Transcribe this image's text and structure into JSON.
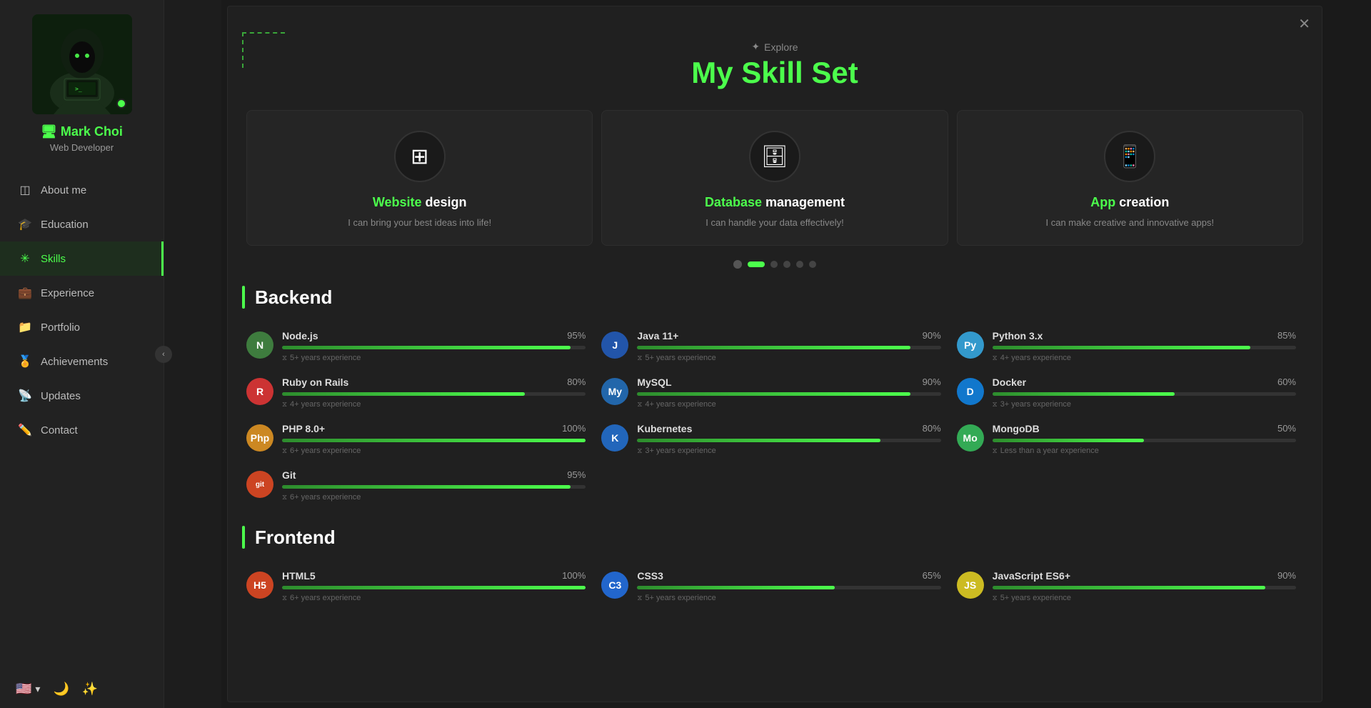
{
  "profile": {
    "name_plain": "Mark",
    "name_colored": " Choi",
    "title": "Web Developer",
    "online": true
  },
  "nav": {
    "items": [
      {
        "id": "about",
        "label": "About me",
        "icon": "👤",
        "active": false
      },
      {
        "id": "education",
        "label": "Education",
        "icon": "🎓",
        "active": false
      },
      {
        "id": "skills",
        "label": "Skills",
        "icon": "✳",
        "active": true
      },
      {
        "id": "experience",
        "label": "Experience",
        "icon": "💼",
        "active": false
      },
      {
        "id": "portfolio",
        "label": "Portfolio",
        "icon": "📁",
        "active": false
      },
      {
        "id": "achievements",
        "label": "Achievements",
        "icon": "🏅",
        "active": false
      },
      {
        "id": "updates",
        "label": "Updates",
        "icon": "📡",
        "active": false
      },
      {
        "id": "contact",
        "label": "Contact",
        "icon": "✏️",
        "active": false
      }
    ]
  },
  "header": {
    "explore_label": "Explore",
    "explore_icon": "✦",
    "title_plain": "My ",
    "title_colored": "Skill",
    "title_rest": " Set"
  },
  "skill_cards": [
    {
      "icon": "⊞",
      "title_green": "Website",
      "title_rest": " design",
      "desc": "I can bring your best ideas into life!"
    },
    {
      "icon": "🗄",
      "title_green": "Database",
      "title_rest": " management",
      "desc": "I can handle your data effectively!"
    },
    {
      "icon": "📱",
      "title_green": "App",
      "title_rest": " creation",
      "desc": "I can make creative and innovative apps!"
    }
  ],
  "sections": {
    "backend": {
      "label": "Backend",
      "skills": [
        {
          "name": "Node.js",
          "pct": 95,
          "pct_label": "95%",
          "exp": "5+ years experience",
          "color": "#3e7c3e",
          "initials": "N"
        },
        {
          "name": "Java 11+",
          "pct": 90,
          "pct_label": "90%",
          "exp": "5+ years experience",
          "color": "#2255aa",
          "initials": "J"
        },
        {
          "name": "Python 3.x",
          "pct": 85,
          "pct_label": "85%",
          "exp": "4+ years experience",
          "color": "#3399cc",
          "initials": "Py"
        },
        {
          "name": "Ruby on Rails",
          "pct": 80,
          "pct_label": "80%",
          "exp": "4+ years experience",
          "color": "#cc3333",
          "initials": "R"
        },
        {
          "name": "MySQL",
          "pct": 90,
          "pct_label": "90%",
          "exp": "4+ years experience",
          "color": "#2266aa",
          "initials": "My"
        },
        {
          "name": "Docker",
          "pct": 60,
          "pct_label": "60%",
          "exp": "3+ years experience",
          "color": "#1177cc",
          "initials": "D"
        },
        {
          "name": "PHP 8.0+",
          "pct": 100,
          "pct_label": "100%",
          "exp": "6+ years experience",
          "color": "#cc8822",
          "initials": "Php"
        },
        {
          "name": "Kubernetes",
          "pct": 80,
          "pct_label": "80%",
          "exp": "3+ years experience",
          "color": "#2266bb",
          "initials": "K"
        },
        {
          "name": "MongoDB",
          "pct": 50,
          "pct_label": "50%",
          "exp": "Less than a year experience",
          "color": "#33aa55",
          "initials": "Mo"
        },
        {
          "name": "Git",
          "pct": 95,
          "pct_label": "95%",
          "exp": "6+ years experience",
          "color": "#cc4422",
          "initials": "git"
        }
      ]
    },
    "frontend": {
      "label": "Frontend",
      "skills": [
        {
          "name": "HTML5",
          "pct": 100,
          "pct_label": "100%",
          "exp": "6+ years experience",
          "color": "#cc4422",
          "initials": "H5"
        },
        {
          "name": "CSS3",
          "pct": 65,
          "pct_label": "65%",
          "exp": "5+ years experience",
          "color": "#2266cc",
          "initials": "C3"
        },
        {
          "name": "JavaScript ES6+",
          "pct": 90,
          "pct_label": "90%",
          "exp": "5+ years experience",
          "color": "#ccbb22",
          "initials": "JS"
        }
      ]
    }
  },
  "carousel": {
    "dots": [
      "prev",
      "active",
      "dot",
      "dot",
      "dot",
      "dot"
    ]
  }
}
